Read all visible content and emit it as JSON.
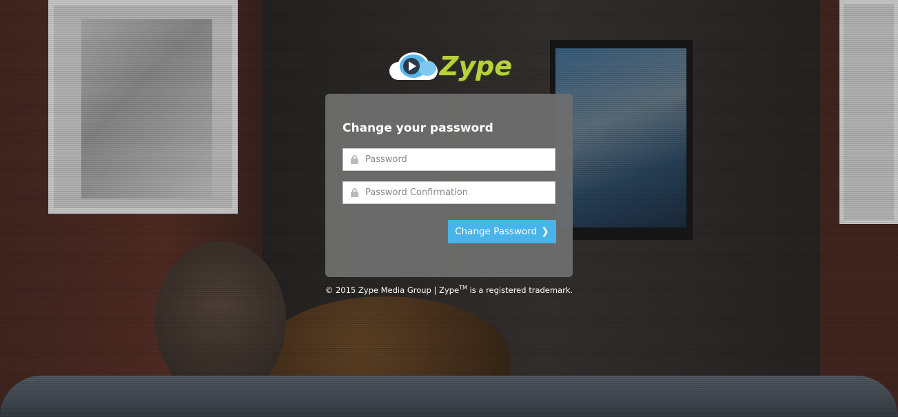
{
  "brand": {
    "name": "Zype"
  },
  "form": {
    "title": "Change your password",
    "password_placeholder": "Password",
    "confirmation_placeholder": "Password Confirmation",
    "submit_label": "Change Password",
    "submit_icon": "chevron-right-icon"
  },
  "footer": {
    "prefix": "© 2015 Zype Media Group | Zype",
    "tm": "TM",
    "suffix": " is a registered trademark."
  },
  "colors": {
    "accent": "#47b5ea",
    "logo_text": "#b7d13b",
    "panel": "#6e6e6e"
  }
}
